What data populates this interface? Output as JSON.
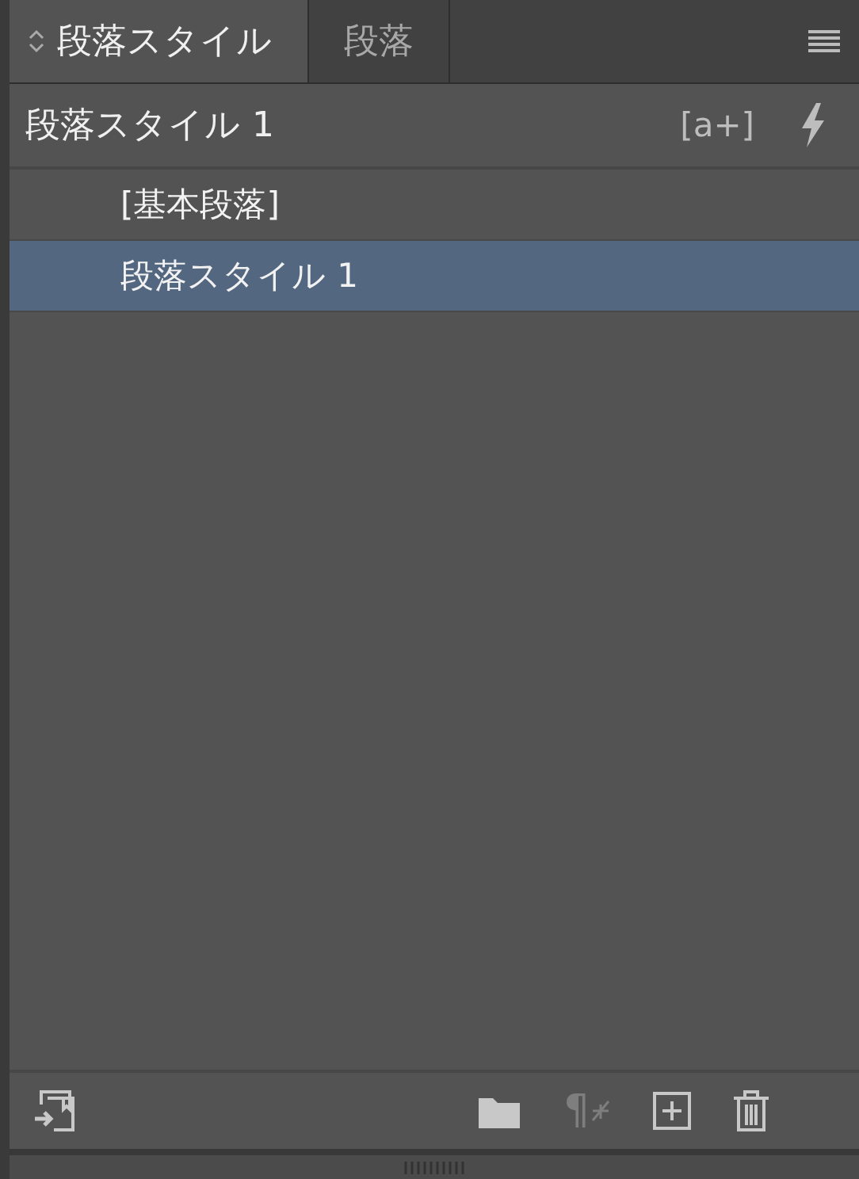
{
  "tabs": [
    {
      "label": "段落スタイル",
      "selected": true
    },
    {
      "label": "段落",
      "selected": false
    }
  ],
  "current_style": "段落スタイル 1",
  "header_buttons": [
    {
      "kind": "text",
      "label": "[a+]"
    },
    {
      "kind": "bolt"
    }
  ],
  "styles": [
    {
      "name": "[基本段落]",
      "selected": false
    },
    {
      "name": "段落スタイル 1",
      "selected": true
    }
  ],
  "footer_buttons": [
    {
      "kind": "load"
    },
    {
      "kind": "folder"
    },
    {
      "kind": "clear",
      "label": "¶",
      "disabled": true
    },
    {
      "kind": "new"
    },
    {
      "kind": "delete"
    }
  ]
}
